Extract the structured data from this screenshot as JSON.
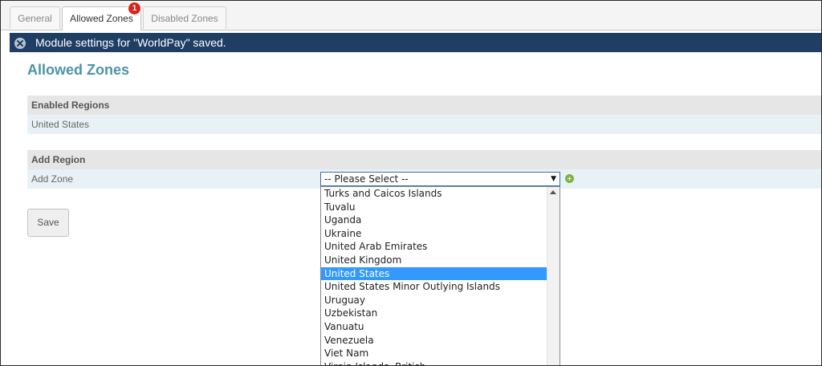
{
  "tabs": [
    {
      "label": "General"
    },
    {
      "label": "Allowed Zones",
      "badge": "1"
    },
    {
      "label": "Disabled Zones"
    }
  ],
  "notification": {
    "text": "Module settings for \"WorldPay\" saved.",
    "icon": "close-circle-icon"
  },
  "page": {
    "title": "Allowed Zones"
  },
  "enabled_regions": {
    "header": "Enabled Regions",
    "items": [
      "United States"
    ]
  },
  "add_region": {
    "header": "Add Region",
    "zone_label": "Add Zone",
    "select_value": "-- Please Select --",
    "options": [
      "Turks and Caicos Islands",
      "Tuvalu",
      "Uganda",
      "Ukraine",
      "United Arab Emirates",
      "United Kingdom",
      "United States",
      "United States Minor Outlying Islands",
      "Uruguay",
      "Uzbekistan",
      "Vanuatu",
      "Venezuela",
      "Viet Nam",
      "Virgin Islands, British"
    ],
    "highlighted_option": "United States"
  },
  "buttons": {
    "save": "Save"
  }
}
